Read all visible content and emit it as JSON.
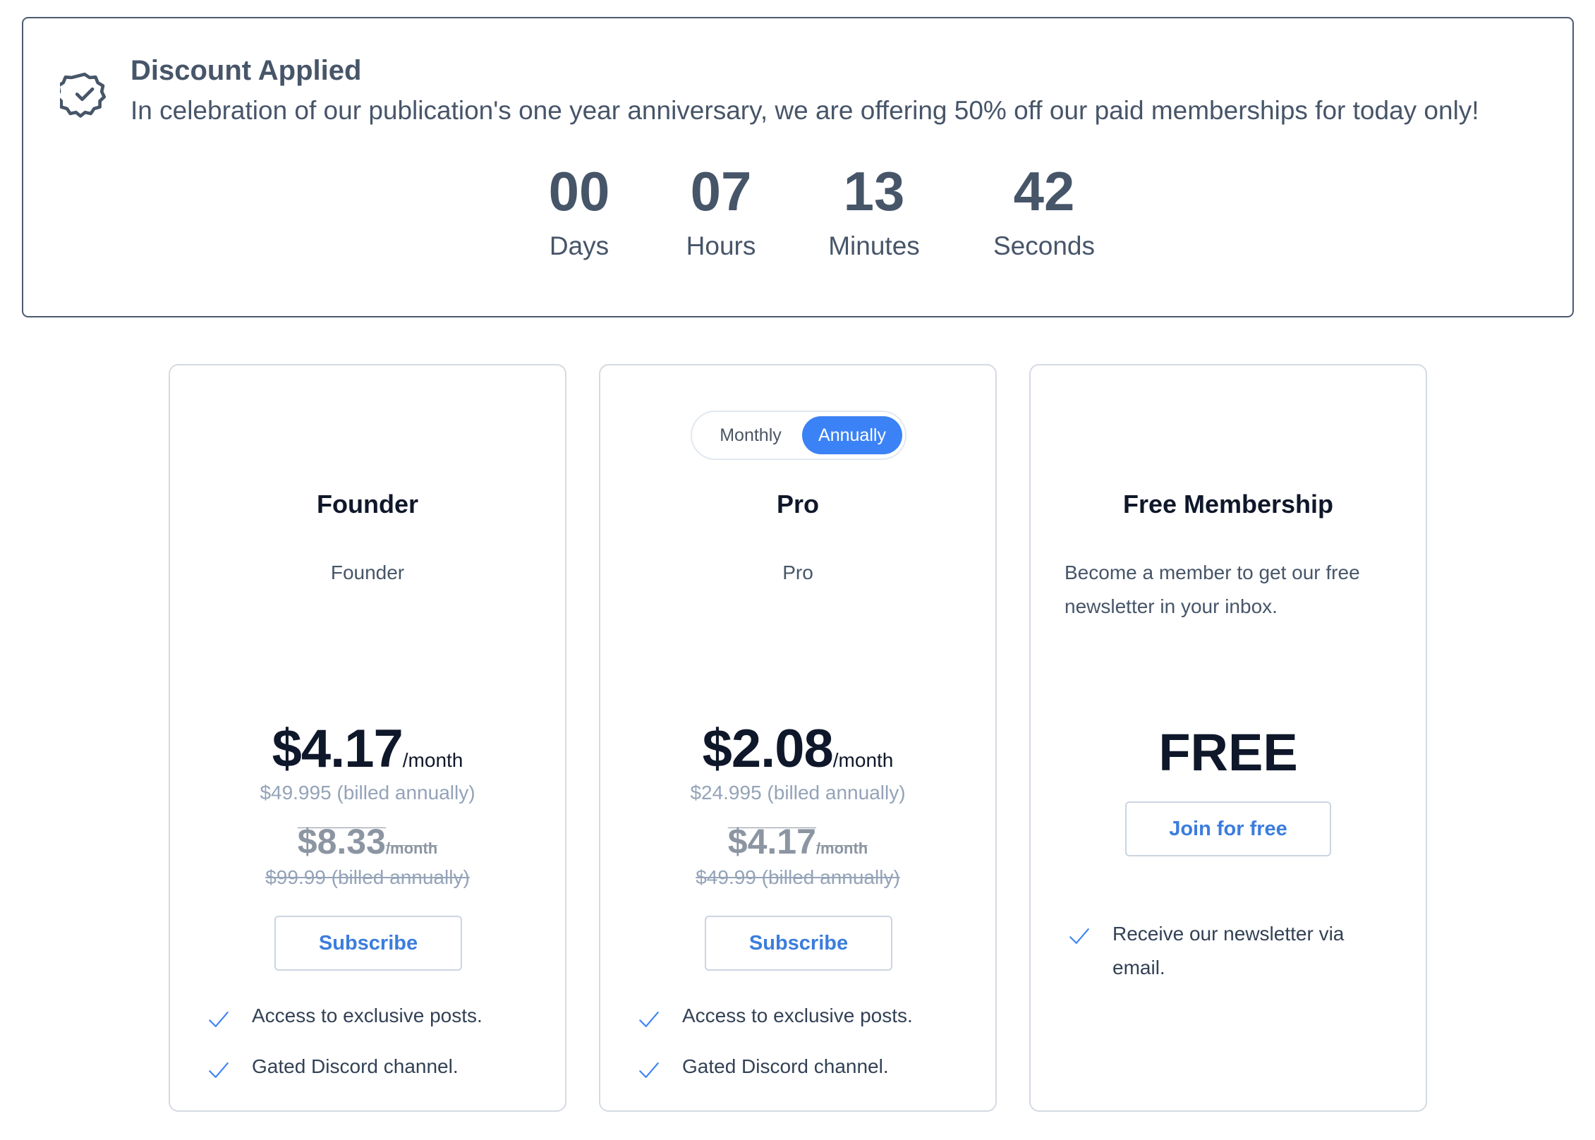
{
  "banner": {
    "title": "Discount Applied",
    "text": "In celebration of our publication's one year anniversary, we are offering 50% off our paid memberships for today only!",
    "icon": "badge-check-icon",
    "countdown": [
      {
        "value": "00",
        "label": "Days"
      },
      {
        "value": "07",
        "label": "Hours"
      },
      {
        "value": "13",
        "label": "Minutes"
      },
      {
        "value": "42",
        "label": "Seconds"
      }
    ]
  },
  "billing_toggle": {
    "options": [
      "Monthly",
      "Annually"
    ],
    "selected": "Annually"
  },
  "plans": [
    {
      "title": "Founder",
      "description": "Founder",
      "price": "$4.17",
      "per": "/month",
      "billed": "$49.995 (billed annually)",
      "old_price": "$8.33",
      "old_per": "/month",
      "old_billed": "$99.99 (billed annually)",
      "button": "Subscribe",
      "features": [
        "Access to exclusive posts.",
        "Gated Discord channel."
      ]
    },
    {
      "title": "Pro",
      "description": "Pro",
      "price": "$2.08",
      "per": "/month",
      "billed": "$24.995 (billed annually)",
      "old_price": "$4.17",
      "old_per": "/month",
      "old_billed": "$49.99 (billed annually)",
      "button": "Subscribe",
      "features": [
        "Access to exclusive posts.",
        "Gated Discord channel."
      ]
    },
    {
      "title": "Free Membership",
      "description": "Become a member to get our free newsletter in your inbox.",
      "price": "FREE",
      "button": "Join for free",
      "features": [
        "Receive our newsletter via email."
      ]
    }
  ],
  "colors": {
    "accent": "#3b82f6",
    "link": "#3b7ddd",
    "text": "#475569",
    "heading": "#0f172a",
    "muted": "#94a3b8"
  }
}
